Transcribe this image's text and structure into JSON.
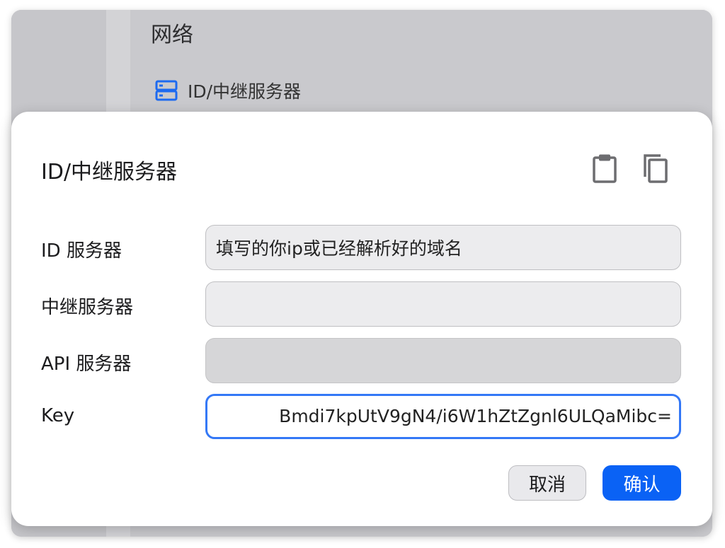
{
  "background": {
    "section_title": "网络",
    "section_item_label": "ID/中继服务器",
    "section_item_icon": "server-icon"
  },
  "dialog": {
    "title": "ID/中继服务器",
    "paste_icon": "clipboard-icon",
    "copy_icon": "copy-icon",
    "fields": {
      "id_server": {
        "label": "ID 服务器",
        "value": "填写的你ip或已经解析好的域名"
      },
      "relay_server": {
        "label": "中继服务器",
        "value": ""
      },
      "api_server": {
        "label": "API 服务器",
        "value": ""
      },
      "key": {
        "label": "Key",
        "value": "Bmdi7kpUtV9gN4/i6W1hZtZgnl6ULQaMibc="
      }
    },
    "buttons": {
      "cancel": "取消",
      "confirm": "确认"
    }
  },
  "colors": {
    "accent": "#0a62f5",
    "focus_ring": "#3478f6",
    "icon_blue": "#1d6af0"
  }
}
